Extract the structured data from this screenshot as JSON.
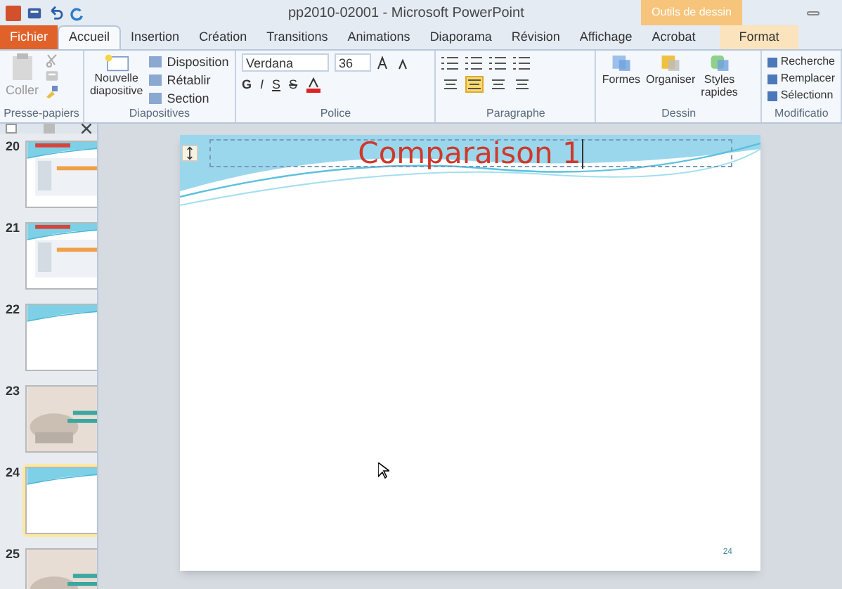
{
  "window": {
    "title": "pp2010-02001  -  Microsoft PowerPoint",
    "context_tab": "Outils de dessin"
  },
  "tabs": [
    {
      "label": "Fichier",
      "kind": "file",
      "selected": false
    },
    {
      "label": "Accueil",
      "kind": "tab",
      "selected": true
    },
    {
      "label": "Insertion",
      "kind": "tab",
      "selected": false
    },
    {
      "label": "Création",
      "kind": "tab",
      "selected": false
    },
    {
      "label": "Transitions",
      "kind": "tab",
      "selected": false
    },
    {
      "label": "Animations",
      "kind": "tab",
      "selected": false
    },
    {
      "label": "Diaporama",
      "kind": "tab",
      "selected": false
    },
    {
      "label": "Révision",
      "kind": "tab",
      "selected": false
    },
    {
      "label": "Affichage",
      "kind": "tab",
      "selected": false
    },
    {
      "label": "Acrobat",
      "kind": "tab",
      "selected": false
    },
    {
      "label": "Format",
      "kind": "context",
      "selected": false
    }
  ],
  "ribbon": {
    "clipboard": {
      "label": "Presse-papiers",
      "paste": "Coller"
    },
    "slides": {
      "label": "Diapositives",
      "new_slide": [
        "Nouvelle",
        "diapositive"
      ],
      "items": [
        "Disposition",
        "Rétablir",
        "Section"
      ]
    },
    "font": {
      "label": "Police",
      "name": "Verdana",
      "size": "36",
      "styles": [
        "G",
        "I",
        "S",
        "S"
      ]
    },
    "paragraph": {
      "label": "Paragraphe",
      "align": [
        {
          "selected": false
        },
        {
          "selected": true
        },
        {
          "selected": false
        },
        {
          "selected": false
        }
      ]
    },
    "drawing": {
      "label": "Dessin",
      "buttons": [
        [
          "Formes"
        ],
        [
          "Organiser"
        ],
        [
          "Styles",
          "rapides"
        ]
      ]
    },
    "editing": {
      "label": "Modificatio",
      "items": [
        "Recherche",
        "Remplacer",
        "Sélectionn"
      ]
    }
  },
  "slides": [
    {
      "number": "20",
      "kind": "content",
      "selected": false
    },
    {
      "number": "21",
      "kind": "content",
      "selected": false
    },
    {
      "number": "22",
      "kind": "blank",
      "selected": false
    },
    {
      "number": "23",
      "kind": "picture",
      "selected": false
    },
    {
      "number": "24",
      "kind": "blank",
      "selected": true
    },
    {
      "number": "25",
      "kind": "picture",
      "selected": false
    }
  ],
  "slide": {
    "title": "Comparaison 1",
    "number": "24"
  }
}
